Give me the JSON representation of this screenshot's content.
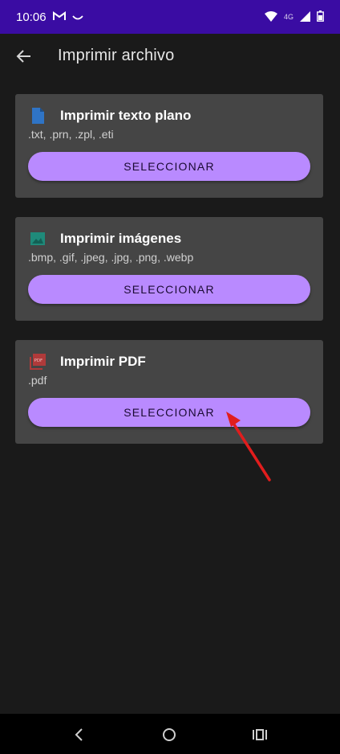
{
  "status_bar": {
    "time": "10:06",
    "network": "4G"
  },
  "appbar": {
    "title": "Imprimir archivo",
    "back_icon": "arrow-back-icon"
  },
  "cards": [
    {
      "icon": "text-file-icon",
      "icon_color": "#2f74c6",
      "title": "Imprimir texto plano",
      "subtitle": ".txt, .prn, .zpl, .eti",
      "button_label": "SELECCIONAR"
    },
    {
      "icon": "image-icon",
      "icon_color": "#1f8a7a",
      "title": "Imprimir imágenes",
      "subtitle": ".bmp, .gif, .jpeg, .jpg, .png, .webp",
      "button_label": "SELECCIONAR"
    },
    {
      "icon": "pdf-file-icon",
      "icon_color": "#b03a3a",
      "title": "Imprimir PDF",
      "subtitle": ".pdf",
      "button_label": "SELECCIONAR"
    }
  ],
  "colors": {
    "status_bar": "#3a0ca3",
    "background": "#1a1a1a",
    "card": "#454545",
    "button": "#b98aff",
    "annotation_arrow": "#e11d1d"
  },
  "nav_bar": {
    "icons": [
      "back-triangle-icon",
      "home-circle-icon",
      "recents-icon"
    ]
  }
}
